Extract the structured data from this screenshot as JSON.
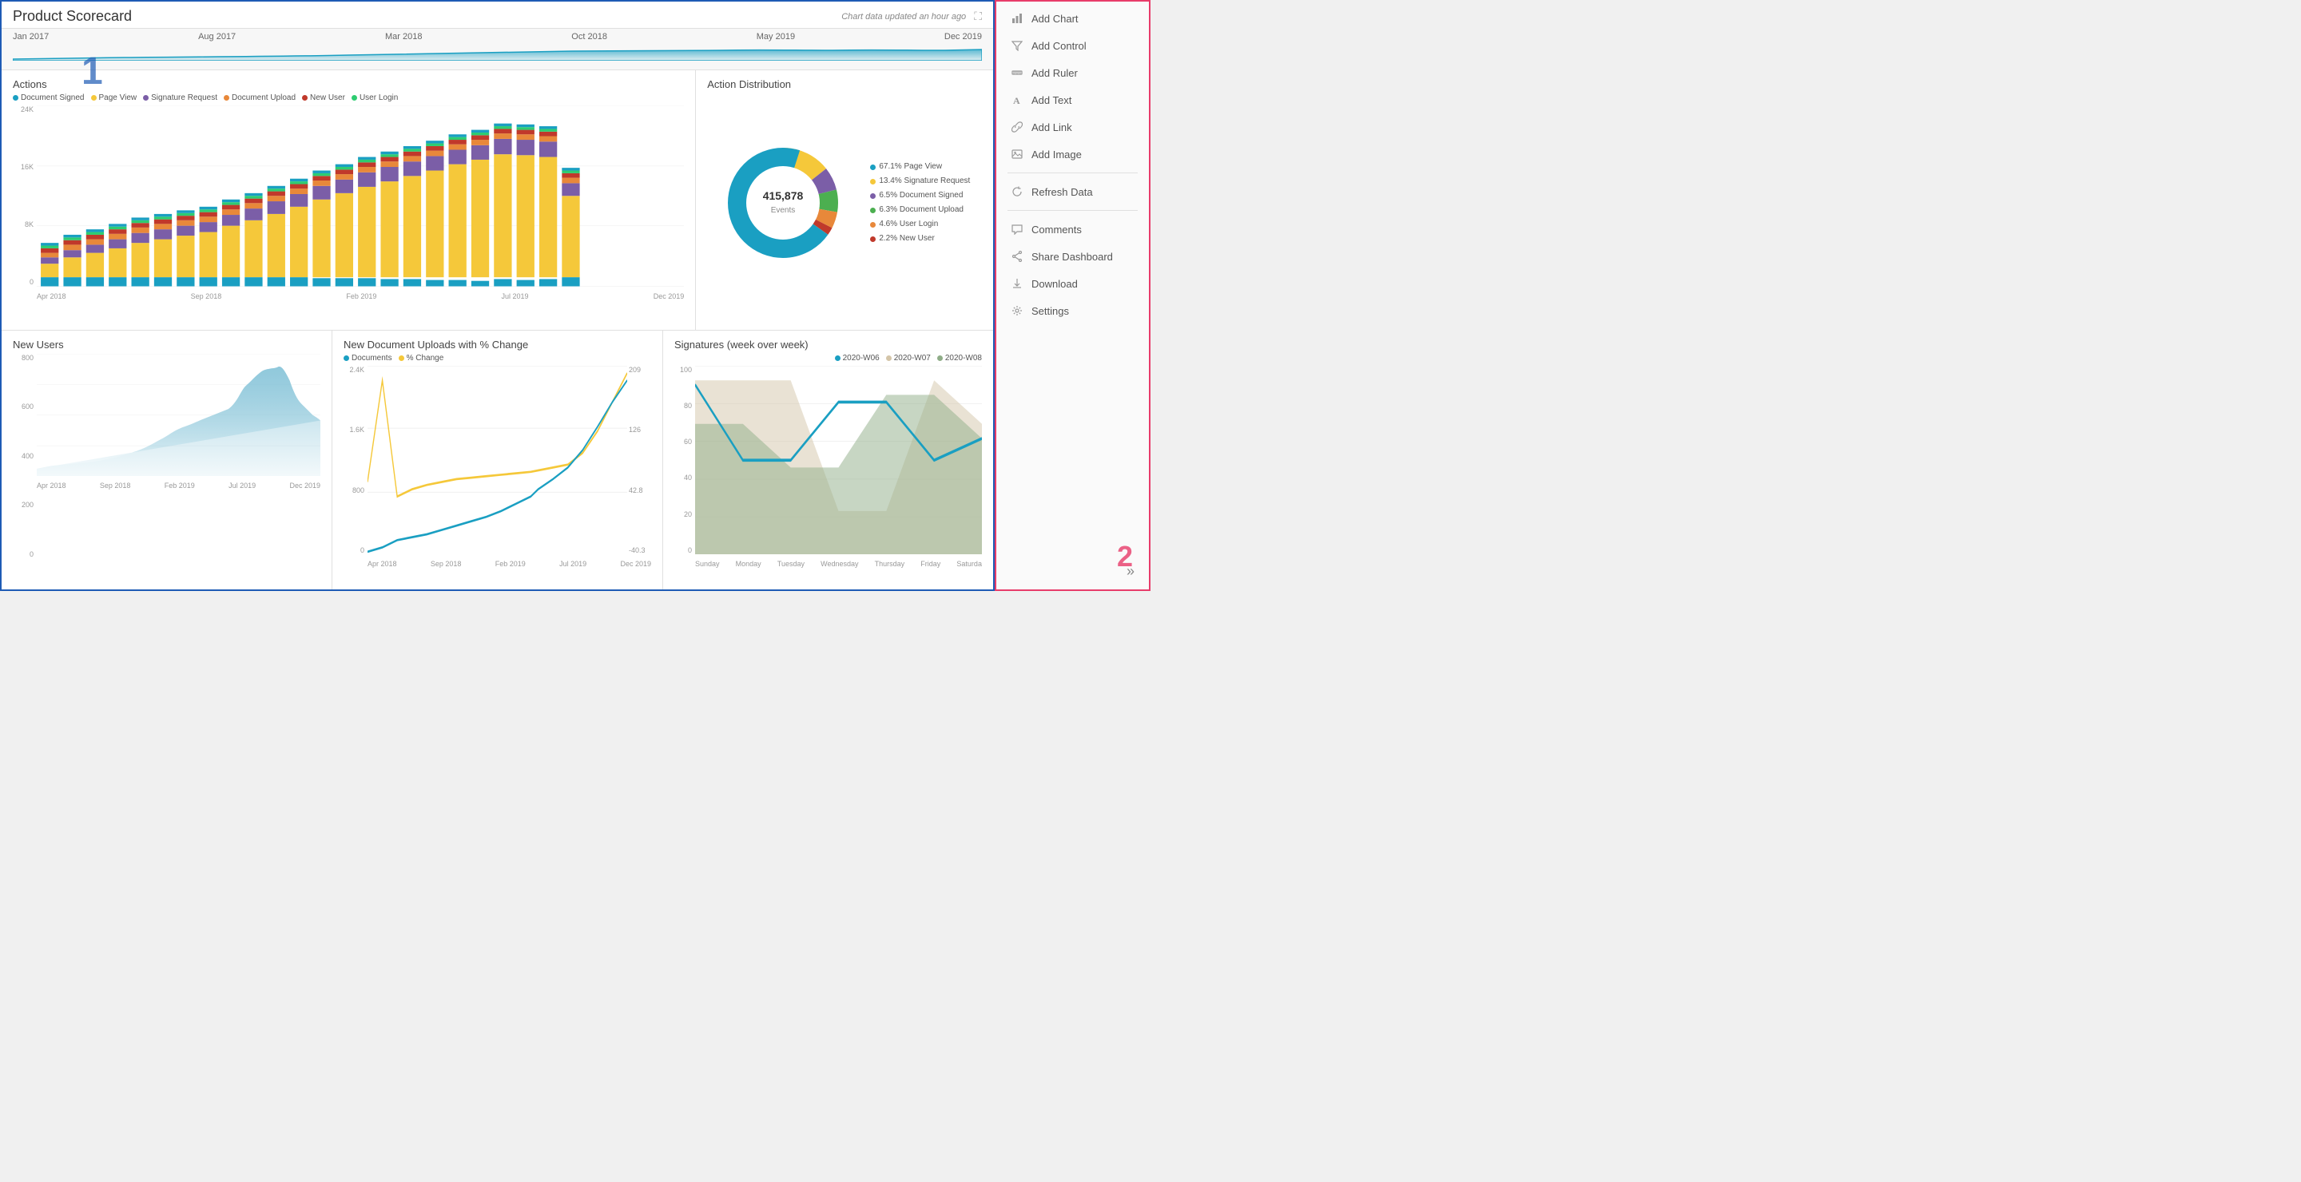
{
  "header": {
    "title": "Product Scorecard",
    "subtitle": "Chart data updated an hour ago"
  },
  "timeline": {
    "labels": [
      "Jan 2017",
      "Aug 2017",
      "Mar 2018",
      "Oct 2018",
      "May 2019",
      "Dec 2019"
    ]
  },
  "actions_chart": {
    "title": "Actions",
    "legend": [
      {
        "label": "Document Signed",
        "color": "#1a9fc2"
      },
      {
        "label": "Page View",
        "color": "#f5c83a"
      },
      {
        "label": "Signature Request",
        "color": "#7b5ea7"
      },
      {
        "label": "Document Upload",
        "color": "#e8883a"
      },
      {
        "label": "New User",
        "color": "#c0392b"
      },
      {
        "label": "User Login",
        "color": "#2ecc71"
      }
    ],
    "y_labels": [
      "24K",
      "16K",
      "8K",
      "0"
    ],
    "x_labels": [
      "Apr 2018",
      "Sep 2018",
      "Feb 2019",
      "Jul 2019",
      "Dec 2019"
    ]
  },
  "distribution_chart": {
    "title": "Action Distribution",
    "total": "415,878",
    "sub": "Events",
    "segments": [
      {
        "label": "67.1% Page View",
        "color": "#1a9fc2",
        "pct": 67.1
      },
      {
        "label": "13.4% Signature Request",
        "color": "#f5c83a",
        "pct": 13.4
      },
      {
        "label": "6.5% Document Signed",
        "color": "#7b5ea7",
        "pct": 6.5
      },
      {
        "label": "6.3% Document Upload",
        "color": "#4caf50",
        "pct": 6.3
      },
      {
        "label": "4.6% User Login",
        "color": "#e8883a",
        "pct": 4.6
      },
      {
        "label": "2.2% New User",
        "color": "#c0392b",
        "pct": 2.2
      }
    ]
  },
  "new_users_chart": {
    "title": "New Users",
    "y_labels": [
      "800",
      "600",
      "400",
      "200",
      "0"
    ],
    "x_labels": [
      "Apr 2018",
      "Sep 2018",
      "Feb 2019",
      "Jul 2019",
      "Dec 2019"
    ]
  },
  "uploads_chart": {
    "title": "New Document Uploads with % Change",
    "legend_docs": "Documents",
    "legend_change": "% Change",
    "docs_color": "#1a9fc2",
    "change_color": "#f5c83a",
    "y_labels": [
      "2.4K",
      "1.6K",
      "800",
      "0"
    ],
    "y_right_labels": [
      "209",
      "126",
      "42.8",
      "-40.3"
    ],
    "x_labels": [
      "Apr 2018",
      "Sep 2018",
      "Feb 2019",
      "Jul 2019",
      "Dec 2019"
    ]
  },
  "signatures_chart": {
    "title": "Signatures (week over week)",
    "legend": [
      {
        "label": "2020-W06",
        "color": "#1a9fc2"
      },
      {
        "label": "2020-W07",
        "color": "#d4c5a9"
      },
      {
        "label": "2020-W08",
        "color": "#8fad88"
      }
    ],
    "y_labels": [
      "100",
      "80",
      "60",
      "40",
      "20",
      "0"
    ],
    "x_labels": [
      "Sunday",
      "Monday",
      "Tuesday",
      "Wednesday",
      "Thursday",
      "Friday",
      "Saturda"
    ]
  },
  "sidebar": {
    "items": [
      {
        "label": "Add Chart",
        "icon": "chart"
      },
      {
        "label": "Add Control",
        "icon": "filter"
      },
      {
        "label": "Add Ruler",
        "icon": "ruler"
      },
      {
        "label": "Add Text",
        "icon": "text"
      },
      {
        "label": "Add Link",
        "icon": "link"
      },
      {
        "label": "Add Image",
        "icon": "image"
      },
      {
        "label": "Refresh Data",
        "icon": "refresh"
      },
      {
        "label": "Comments",
        "icon": "comment"
      },
      {
        "label": "Share Dashboard",
        "icon": "share"
      },
      {
        "label": "Download",
        "icon": "download"
      },
      {
        "label": "Settings",
        "icon": "settings"
      }
    ],
    "collapse_icon": "»"
  }
}
